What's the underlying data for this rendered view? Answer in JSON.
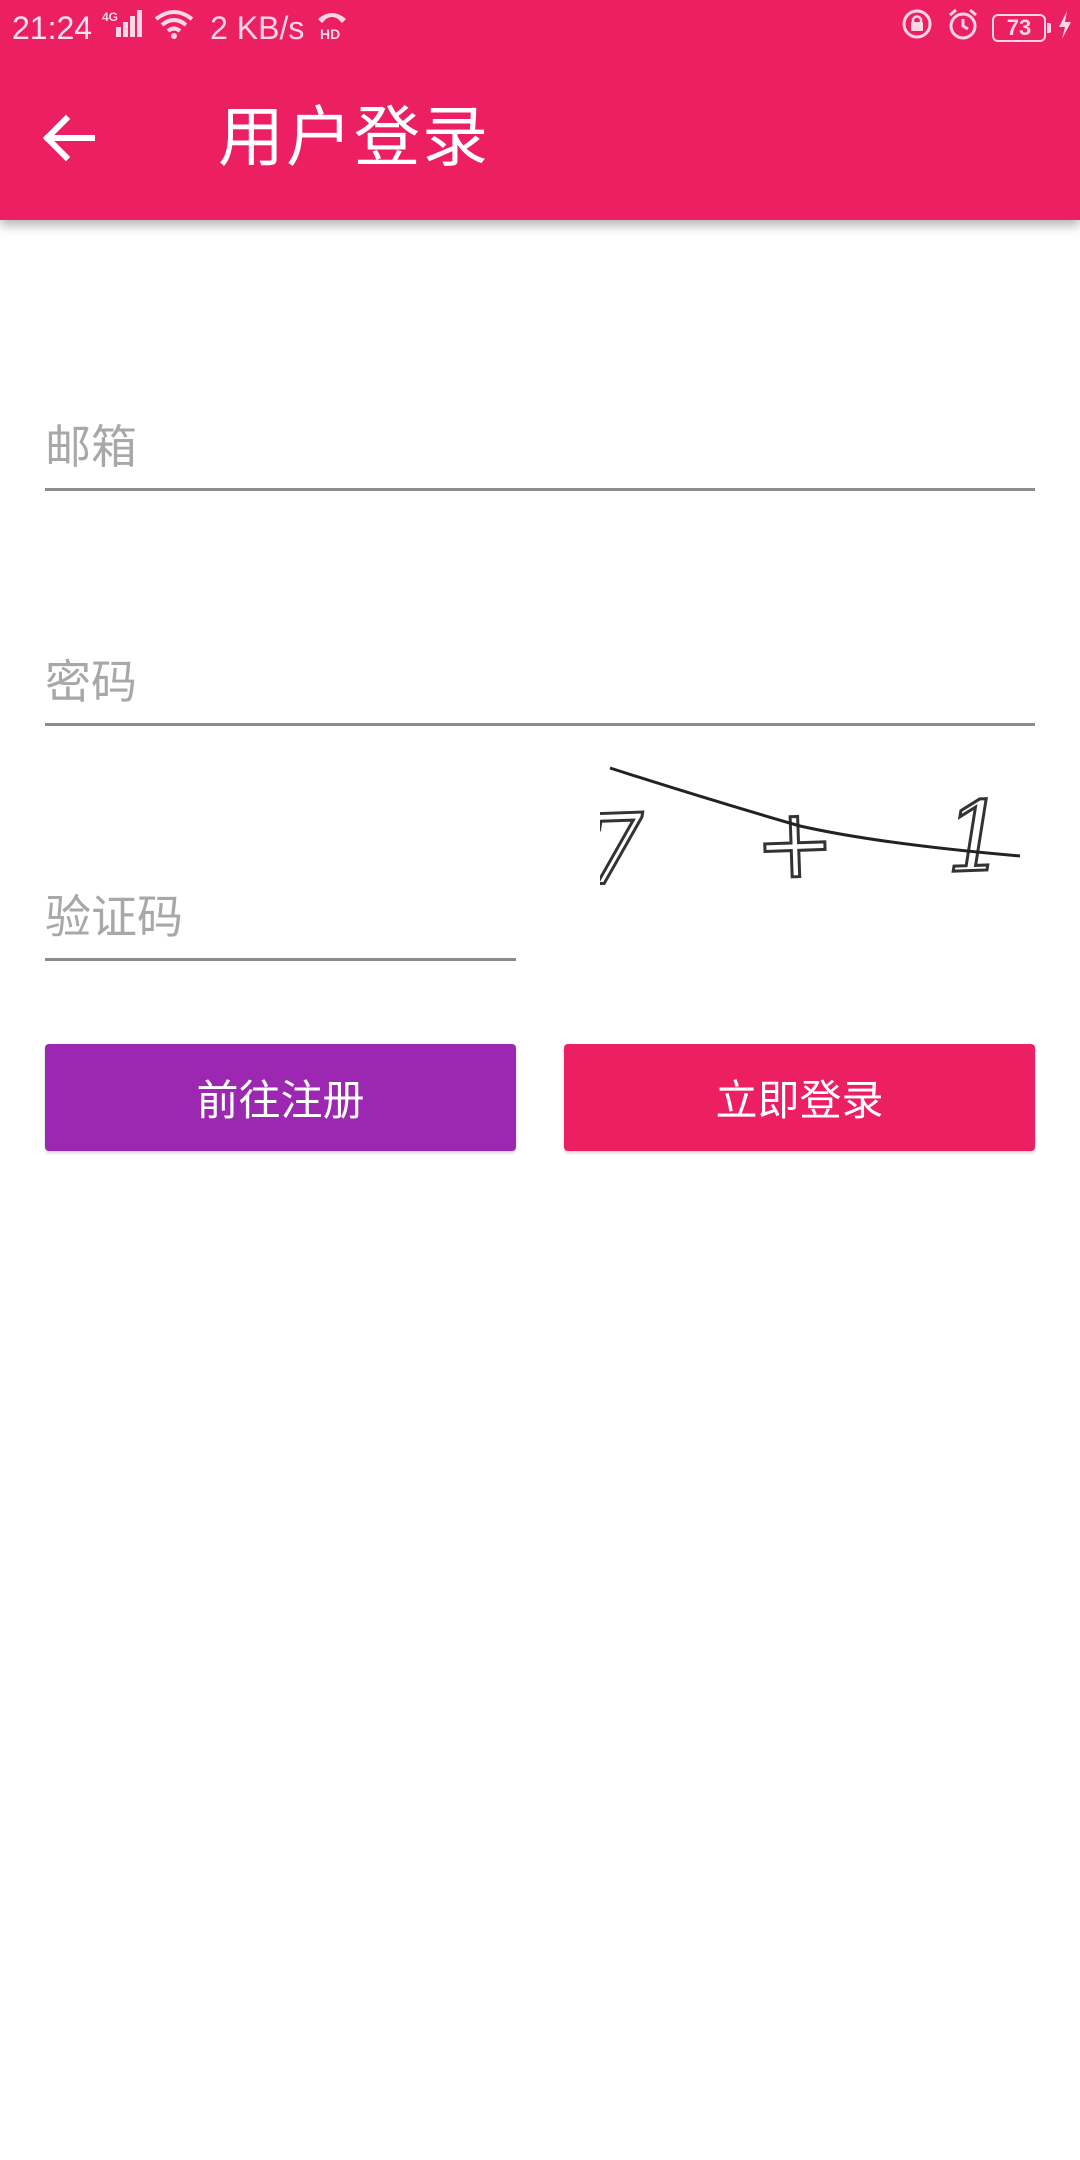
{
  "status_bar": {
    "time": "21:24",
    "network_type": "4G",
    "net_speed": "2 KB/s",
    "battery_level": "73"
  },
  "app_bar": {
    "title": "用户登录",
    "color": "#ec1f63"
  },
  "form": {
    "email_placeholder": "邮箱",
    "password_placeholder": "密码",
    "captcha_placeholder": "验证码",
    "captcha_text": "7 + 1"
  },
  "buttons": {
    "register_label": "前往注册",
    "register_color": "#9c27b0",
    "login_label": "立即登录",
    "login_color": "#ec1f63"
  }
}
